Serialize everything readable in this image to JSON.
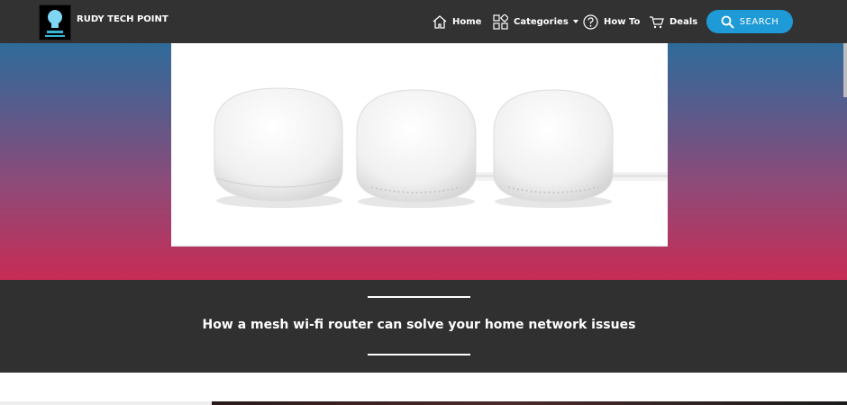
{
  "brand": {
    "name": "RUDY TECH POINT",
    "logo_icon": "lightbulb-icon"
  },
  "nav": {
    "home": {
      "label": "Home",
      "icon": "home-icon"
    },
    "categories": {
      "label": "Categories",
      "icon": "grid-icon"
    },
    "howto": {
      "label": "How To",
      "icon": "question-circle-icon"
    },
    "deals": {
      "label": "Deals",
      "icon": "cart-icon"
    },
    "search": {
      "label": "SEARCH",
      "icon": "search-icon"
    }
  },
  "article": {
    "title": "How a mesh wi-fi router can solve your home network issues",
    "image_alt": "three white mesh wi-fi router units"
  },
  "colors": {
    "topbar": "#323232",
    "accent": "#1e9ad6",
    "gradient_top": "#2f6b9a",
    "gradient_bottom": "#c72b55",
    "title_band": "#303030"
  }
}
